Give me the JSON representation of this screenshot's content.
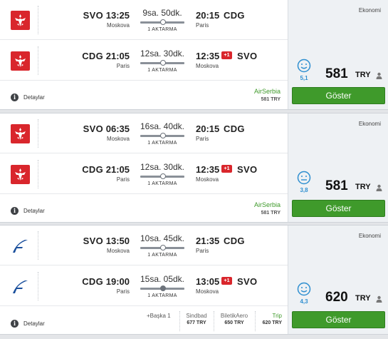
{
  "results": [
    {
      "airline_logo": "airserbia-logo",
      "cabin": "Ekonomi",
      "legs": [
        {
          "dep_code": "SVO",
          "dep_time": "13:25",
          "dep_city": "Moskova",
          "duration": "9sa. 50dk.",
          "stops": "1 AKTARMA",
          "arr_time": "20:15",
          "arr_code": "CDG",
          "arr_city": "Paris",
          "plus_day": ""
        },
        {
          "dep_code": "CDG",
          "dep_time": "21:05",
          "dep_city": "Paris",
          "duration": "12sa. 30dk.",
          "stops": "1 AKTARMA",
          "arr_time": "12:35",
          "arr_code": "SVO",
          "arr_city": "Moskova",
          "plus_day": "+1"
        }
      ],
      "details_label": "Detaylar",
      "airline_name": "AirSerbia",
      "airline_price": "581 TRY",
      "score": "5,1",
      "price": "581",
      "currency": "TRY",
      "button_label": "Göster"
    },
    {
      "airline_logo": "airserbia-logo",
      "cabin": "Ekonomi",
      "legs": [
        {
          "dep_code": "SVO",
          "dep_time": "06:35",
          "dep_city": "Moskova",
          "duration": "16sa. 40dk.",
          "stops": "1 AKTARMA",
          "arr_time": "20:15",
          "arr_code": "CDG",
          "arr_city": "Paris",
          "plus_day": ""
        },
        {
          "dep_code": "CDG",
          "dep_time": "21:05",
          "dep_city": "Paris",
          "duration": "12sa. 30dk.",
          "stops": "1 AKTARMA",
          "arr_time": "12:35",
          "arr_code": "SVO",
          "arr_city": "Moskova",
          "plus_day": "+1"
        }
      ],
      "details_label": "Detaylar",
      "airline_name": "AirSerbia",
      "airline_price": "581 TRY",
      "score": "3,8",
      "price": "581",
      "currency": "TRY",
      "button_label": "Göster"
    },
    {
      "airline_logo": "finnair-logo",
      "cabin": "Ekonomi",
      "legs": [
        {
          "dep_code": "SVO",
          "dep_time": "13:50",
          "dep_city": "Moskova",
          "duration": "10sa. 45dk.",
          "stops": "1 AKTARMA",
          "arr_time": "21:35",
          "arr_code": "CDG",
          "arr_city": "Paris",
          "plus_day": ""
        },
        {
          "dep_code": "CDG",
          "dep_time": "19:00",
          "dep_city": "Paris",
          "duration": "15sa. 05dk.",
          "stops": "1 AKTARMA",
          "arr_time": "13:05",
          "arr_code": "SVO",
          "arr_city": "Moskova",
          "plus_day": "+1"
        }
      ],
      "details_label": "Detaylar",
      "more_agents": "+Başka 1",
      "agents": [
        {
          "name": "Sindbad",
          "price": "677 TRY"
        },
        {
          "name": "BiletikAero",
          "price": "650 TRY"
        },
        {
          "name": "Trip",
          "price": "620 TRY"
        }
      ],
      "score": "4,3",
      "price": "620",
      "currency": "TRY",
      "button_label": "Göster"
    }
  ],
  "colors": {
    "accent_green": "#3f9a2b",
    "airserbia_red": "#d9262c",
    "finnair_blue": "#1a4f9c",
    "score_blue": "#2f8fd0"
  }
}
